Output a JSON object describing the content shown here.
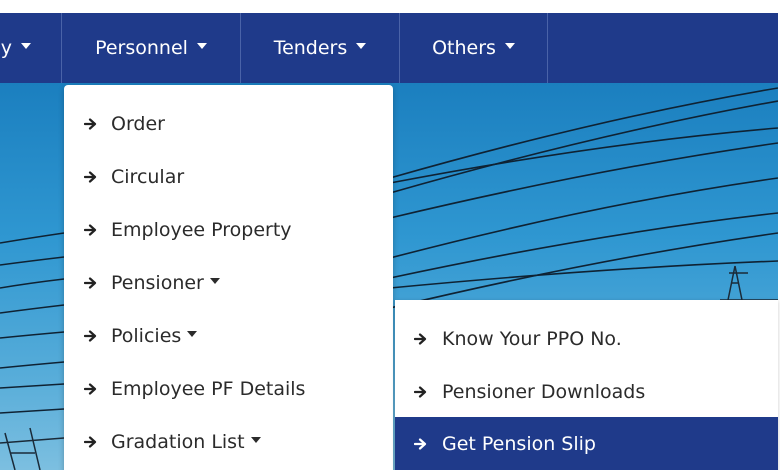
{
  "navbar": {
    "items": [
      {
        "label": "y",
        "has_caret": true
      },
      {
        "label": "Personnel",
        "has_caret": true
      },
      {
        "label": "Tenders",
        "has_caret": true
      },
      {
        "label": "Others",
        "has_caret": true
      }
    ]
  },
  "dropdown": {
    "items": [
      {
        "label": "Order",
        "icon": "arrow-right-icon"
      },
      {
        "label": "Circular",
        "icon": "arrow-right-icon"
      },
      {
        "label": "Employee Property",
        "icon": "arrow-right-icon"
      },
      {
        "label": "Pensioner",
        "icon": "arrow-right-icon",
        "has_caret": true
      },
      {
        "label": "Policies",
        "icon": "arrow-right-icon",
        "has_caret": true
      },
      {
        "label": "Employee PF Details",
        "icon": "arrow-right-icon"
      },
      {
        "label": "Gradation List",
        "icon": "arrow-right-icon",
        "has_caret": true
      }
    ]
  },
  "submenu": {
    "items": [
      {
        "label": "Know Your PPO No.",
        "icon": "arrow-right-icon",
        "active": false
      },
      {
        "label": "Pensioner Downloads",
        "icon": "arrow-right-icon",
        "active": false
      },
      {
        "label": "Get Pension Slip",
        "icon": "arrow-right-icon",
        "active": true
      }
    ]
  },
  "colors": {
    "navbar_bg": "#1f3a8a",
    "active_item_bg": "#1f3a8a",
    "sky": "#2f97d1",
    "text": "#2b2b2b"
  }
}
